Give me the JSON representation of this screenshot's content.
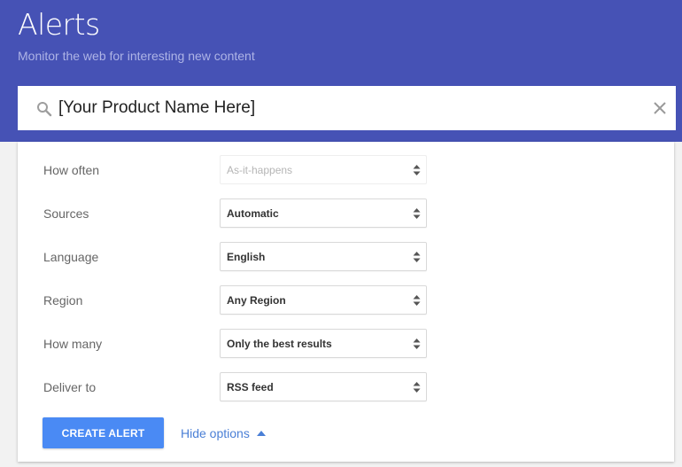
{
  "header": {
    "title": "Alerts",
    "subtitle": "Monitor the web for interesting new content",
    "background_color": "#4652b5"
  },
  "search": {
    "value": "[Your Product Name Here]",
    "search_icon": "search-icon",
    "clear_icon": "close-icon"
  },
  "options": [
    {
      "label": "How often",
      "value": "As-it-happens",
      "disabled": true
    },
    {
      "label": "Sources",
      "value": "Automatic",
      "disabled": false
    },
    {
      "label": "Language",
      "value": "English",
      "disabled": false
    },
    {
      "label": "Region",
      "value": "Any Region",
      "disabled": false
    },
    {
      "label": "How many",
      "value": "Only the best results",
      "disabled": false
    },
    {
      "label": "Deliver to",
      "value": "RSS feed",
      "disabled": false
    }
  ],
  "actions": {
    "create_label": "CREATE ALERT",
    "create_color": "#4a8af4",
    "hide_options_label": "Hide options",
    "hide_options_icon": "caret-up-icon"
  }
}
